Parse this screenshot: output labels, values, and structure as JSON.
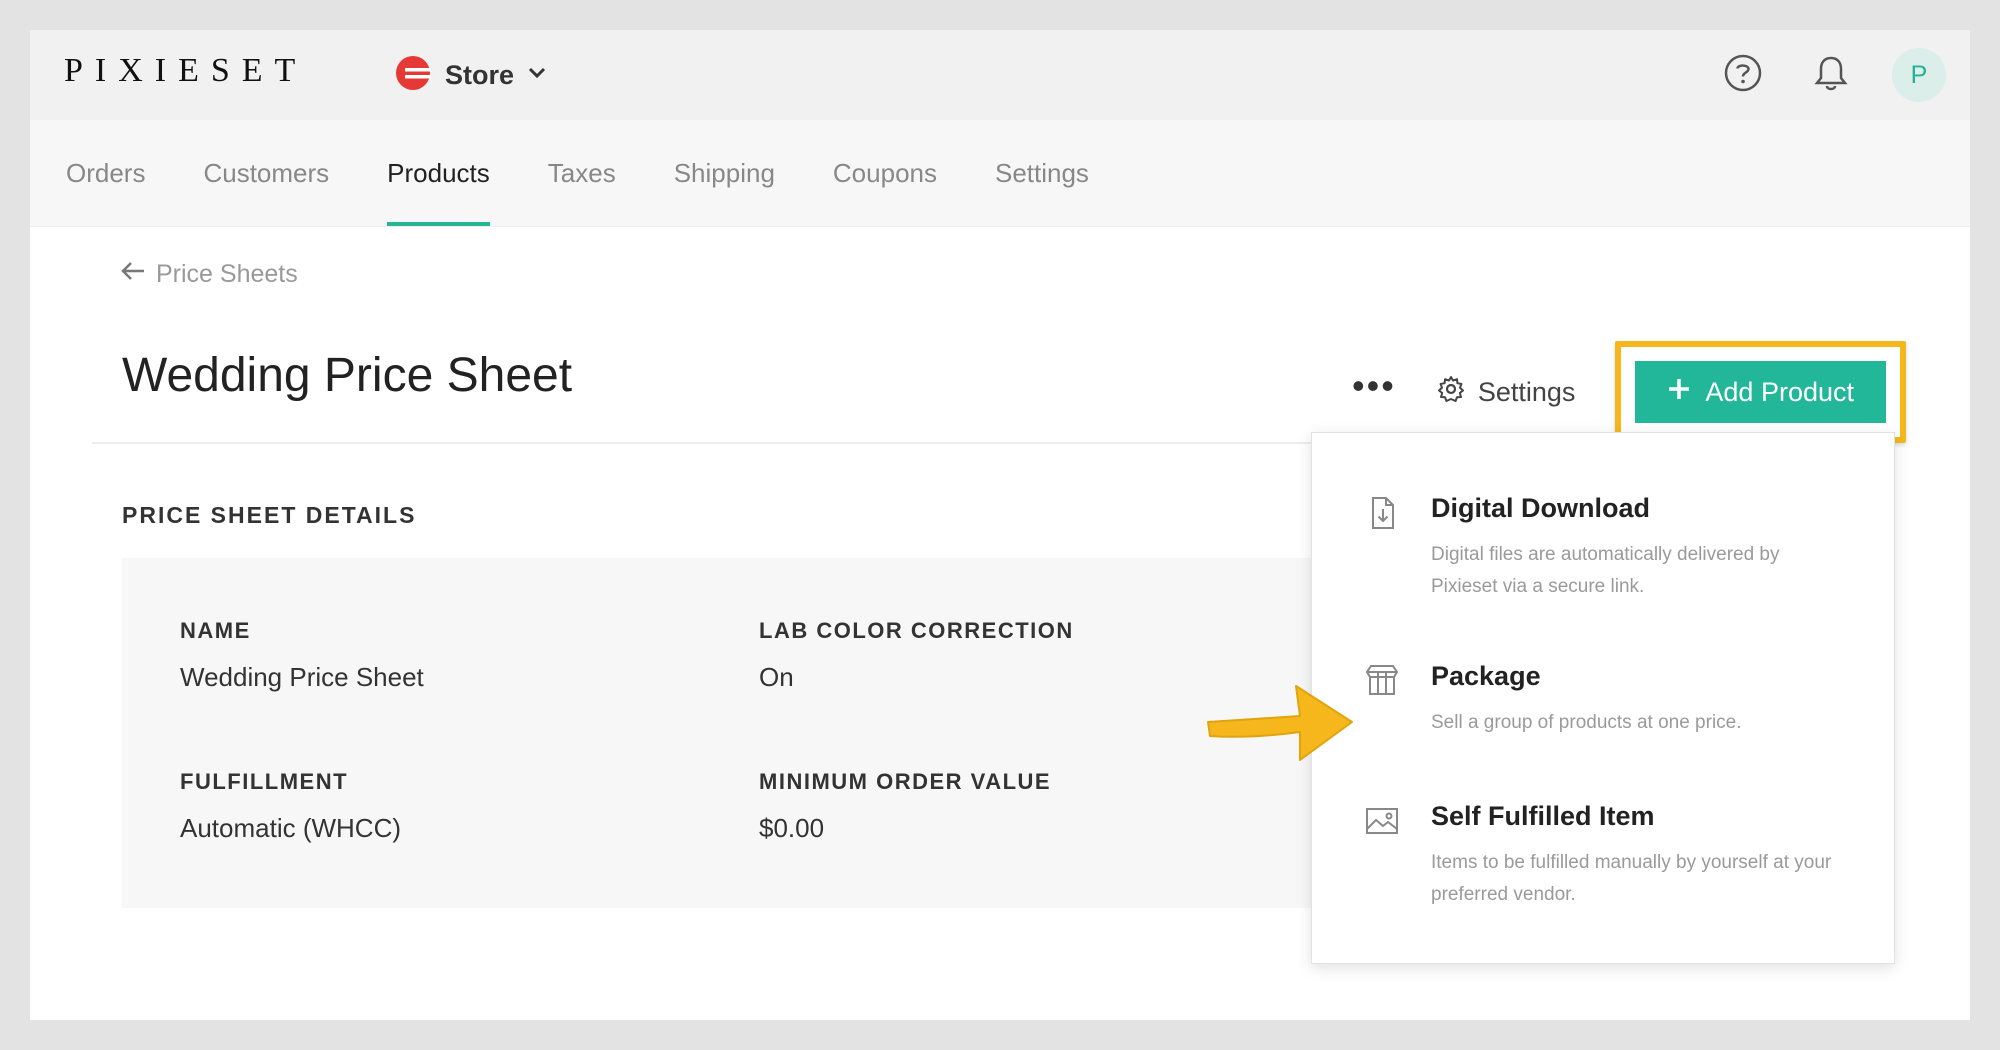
{
  "app": {
    "logo": "PIXIESET",
    "store_label": "Store"
  },
  "colors": {
    "accent": "#22b798",
    "highlight": "#f5b71c",
    "brand_red": "#e53935"
  },
  "header_icons": [
    "help-icon",
    "bell-icon"
  ],
  "avatar": {
    "initial": "P"
  },
  "nav": {
    "tabs": [
      {
        "label": "Orders"
      },
      {
        "label": "Customers"
      },
      {
        "label": "Products",
        "active": true
      },
      {
        "label": "Taxes"
      },
      {
        "label": "Shipping"
      },
      {
        "label": "Coupons"
      },
      {
        "label": "Settings"
      }
    ]
  },
  "breadcrumb": {
    "back_label": "Price Sheets"
  },
  "page": {
    "title": "Wedding Price Sheet",
    "more_label": "•••",
    "settings_label": "Settings",
    "add_product_label": "Add Product"
  },
  "details": {
    "section_title": "PRICE SHEET DETAILS",
    "fields": [
      {
        "label": "NAME",
        "value": "Wedding Price Sheet"
      },
      {
        "label": "LAB COLOR CORRECTION",
        "value": "On"
      },
      {
        "label": "FULFILLMENT",
        "value": "Automatic (WHCC)"
      },
      {
        "label": "MINIMUM ORDER VALUE",
        "value": "$0.00"
      }
    ]
  },
  "add_menu": {
    "items": [
      {
        "title": "Digital Download",
        "description": "Digital files are automatically delivered by Pixieset via a secure link.",
        "icon": "file-download-icon"
      },
      {
        "title": "Package",
        "description": "Sell a group of products at one price.",
        "icon": "package-box-icon"
      },
      {
        "title": "Self Fulfilled Item",
        "description": "Items to be fulfilled manually by yourself at your preferred vendor.",
        "icon": "image-icon"
      }
    ]
  }
}
